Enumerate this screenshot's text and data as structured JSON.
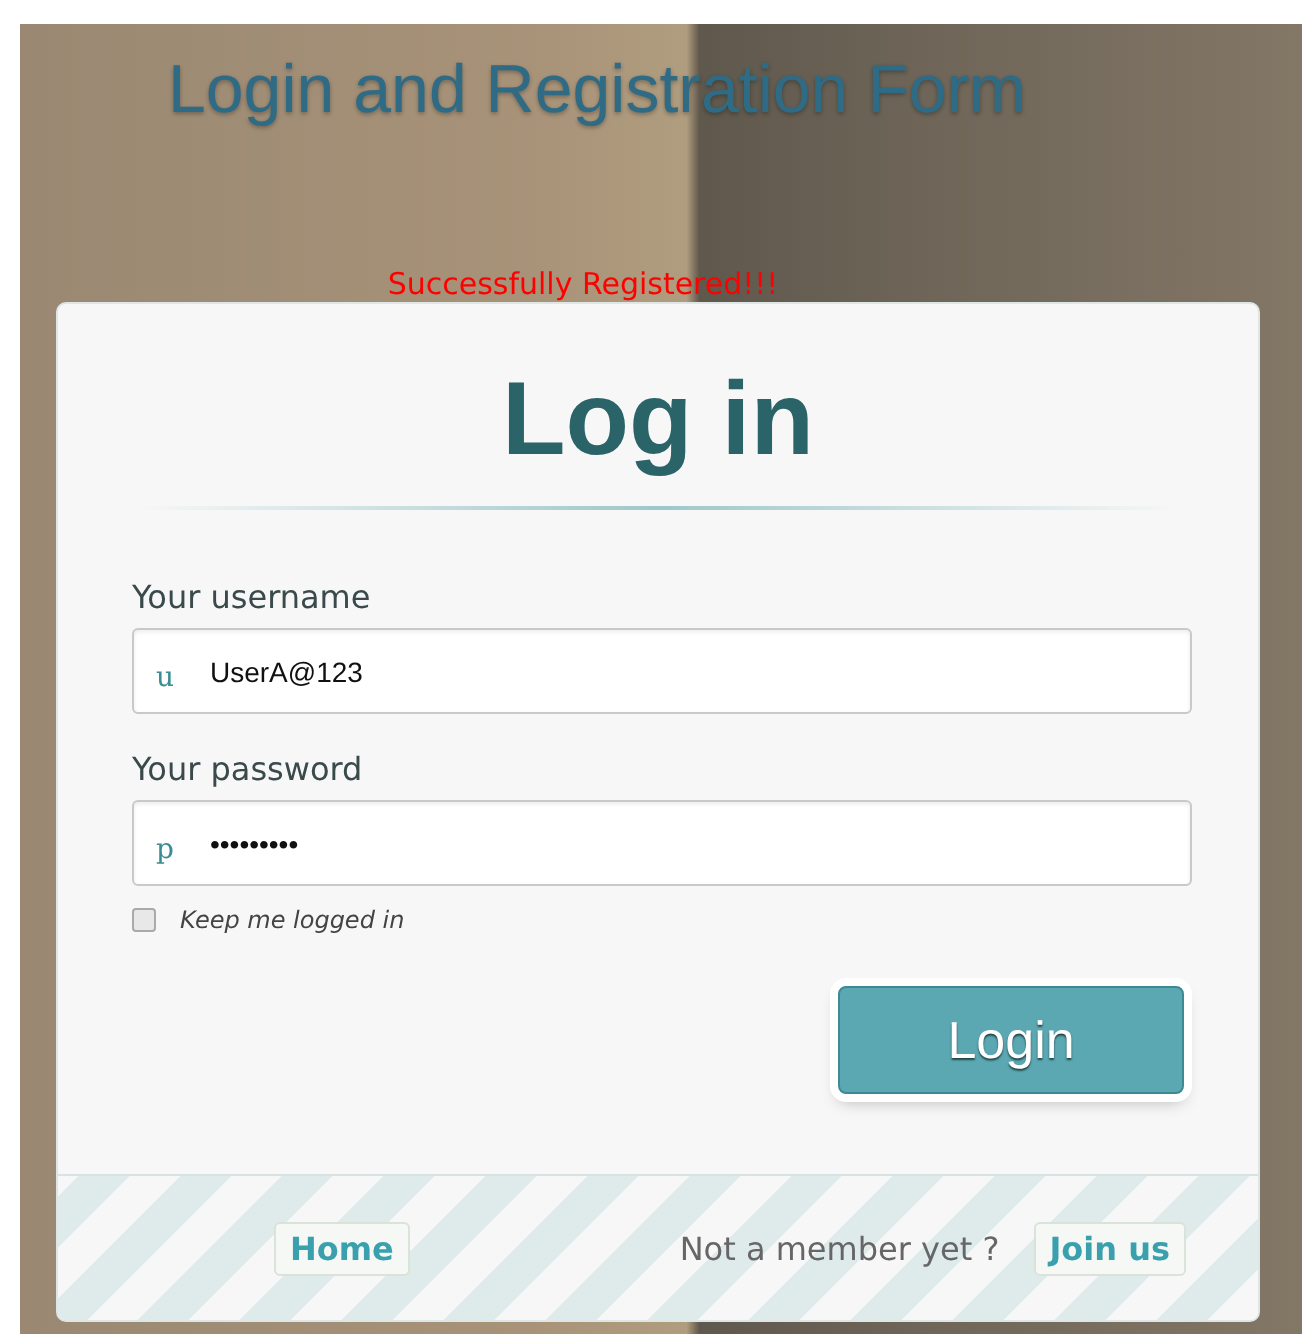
{
  "page": {
    "title": "Login and Registration Form",
    "message": "Successfully Registered!!!"
  },
  "form": {
    "heading": "Log in",
    "fields": [
      {
        "label": "Your username",
        "prefix": "u",
        "value": "UserA@123"
      },
      {
        "label": "Your password",
        "prefix": "p",
        "value": "•••••••••"
      }
    ],
    "keep_logged_in": {
      "label": "Keep me logged in",
      "checked": false
    },
    "submit": "Login"
  },
  "footer": {
    "home": "Home",
    "prompt": "Not a member yet ?",
    "join": "Join us"
  }
}
